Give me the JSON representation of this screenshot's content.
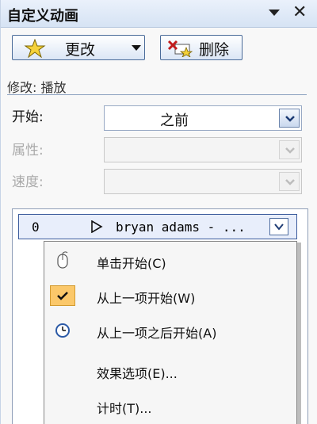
{
  "pane": {
    "title": "自定义动画"
  },
  "toolbar": {
    "change_label": "更改",
    "delete_label": "删除"
  },
  "section": {
    "modify_label": "修改: 播放"
  },
  "fields": {
    "start": {
      "label": "开始:",
      "value": "之前"
    },
    "property": {
      "label": "属性:",
      "value": ""
    },
    "speed": {
      "label": "速度:",
      "value": ""
    }
  },
  "list_item": {
    "index": "0",
    "text": "bryan adams - ..."
  },
  "context_menu": {
    "items": [
      {
        "label": "单击开始(C)",
        "icon": "mouse-icon"
      },
      {
        "label": "从上一项开始(W)",
        "icon": "checkmark-icon",
        "checked": true
      },
      {
        "label": "从上一项之后开始(A)",
        "icon": "clock-icon"
      },
      {
        "label": "效果选项(E)...",
        "icon": ""
      },
      {
        "label": "计时(T)...",
        "icon": ""
      }
    ]
  },
  "colors": {
    "title_bar": "#d6e3f4",
    "selection_border": "#3b5b9c",
    "check_bg": "#fbc86a"
  }
}
